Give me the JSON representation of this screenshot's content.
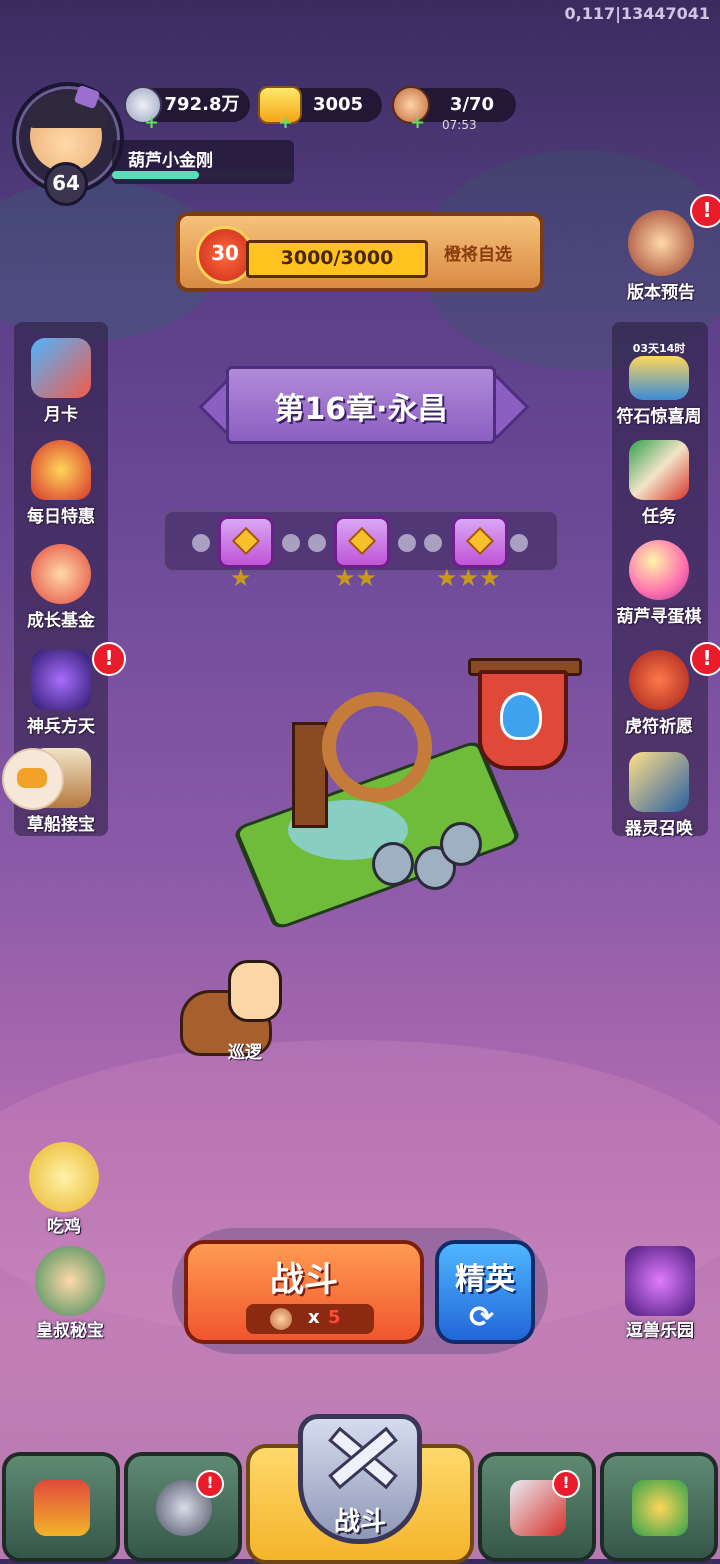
{
  "debug_text": "0,117|13447041",
  "player": {
    "name": "葫芦小金刚",
    "level": "64",
    "xp_fraction": 0.48
  },
  "resources": {
    "silver": "792.8万",
    "gold": "3005",
    "stamina": "3/70",
    "stamina_timer": "07:53",
    "plus": "+"
  },
  "banner": {
    "medal_level": "30",
    "progress": "3000/3000",
    "pick_label": "橙将自选"
  },
  "left_menu": [
    {
      "label": "月卡"
    },
    {
      "label": "每日特惠"
    },
    {
      "label": "成长基金"
    },
    {
      "label": "神兵方天",
      "alert": "!"
    },
    {
      "label": "草船接宝"
    }
  ],
  "right_menu": [
    {
      "label": "版本预告",
      "alert": "!"
    },
    {
      "label": "符石惊喜周",
      "timer": "03天14时"
    },
    {
      "label": "任务"
    },
    {
      "label": "葫芦寻蛋棋"
    },
    {
      "label": "虎符祈愿",
      "alert": "!"
    },
    {
      "label": "器灵召唤"
    }
  ],
  "chapter_title": "第16章·永昌",
  "chest_stars": [
    "★",
    "★★",
    "★★★"
  ],
  "patrol_label": "巡逻",
  "side_chars": {
    "chicken": "吃鸡",
    "uncle": "皇叔秘宝",
    "beast": "逗兽乐园"
  },
  "battle": {
    "fight_label": "战斗",
    "cost_multiplier": "x",
    "cost_value": "5",
    "elite_label": "精英",
    "refresh_icon": "⟳"
  },
  "nav": {
    "center_label": "战斗",
    "alert": "!"
  },
  "colors": {
    "alert_red": "#e81c2a",
    "xp_green": "#55e0b9",
    "fight_orange": "#f0562d",
    "elite_blue": "#2166d8"
  }
}
